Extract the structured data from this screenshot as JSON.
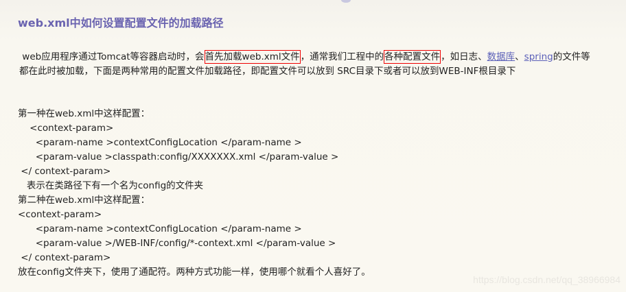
{
  "title": "web.xml中如何设置配置文件的加载路径",
  "intro": {
    "pre": " web应用程序通过Tomcat等容器启动时，会",
    "box1": "首先加载web.xml文件",
    "mid": "，通常我们工程中的",
    "box2": "各种配置文件",
    "mid2": "，如日志、",
    "link1": "数据库",
    "sep": "、",
    "link2": "spring",
    "post": "的文件等",
    "line2": "都在此时被加载，下面是两种常用的配置文件加载路径，即配置文件可以放到 SRC目录下或者可以放到WEB-INF根目录下"
  },
  "lines": [
    "第一种在web.xml中这样配置：",
    "    <context-param>",
    "      <param-name >contextConfigLocation </param-name >",
    "      <param-value >classpath:config/XXXXXXX.xml </param-value >",
    " </ context-param>",
    "   表示在类路径下有一个名为config的文件夹",
    "第二种在web.xml中这样配置：",
    "<context-param>",
    "      <param-name >contextConfigLocation </param-name >",
    "      <param-value >/WEB-INF/config/*-context.xml </param-value >",
    " </ context-param>",
    "放在config文件夹下，使用了通配符。两种方式功能一样，使用哪个就看个人喜好了。"
  ],
  "watermark": "https://blog.csdn.net/qq_38966984"
}
